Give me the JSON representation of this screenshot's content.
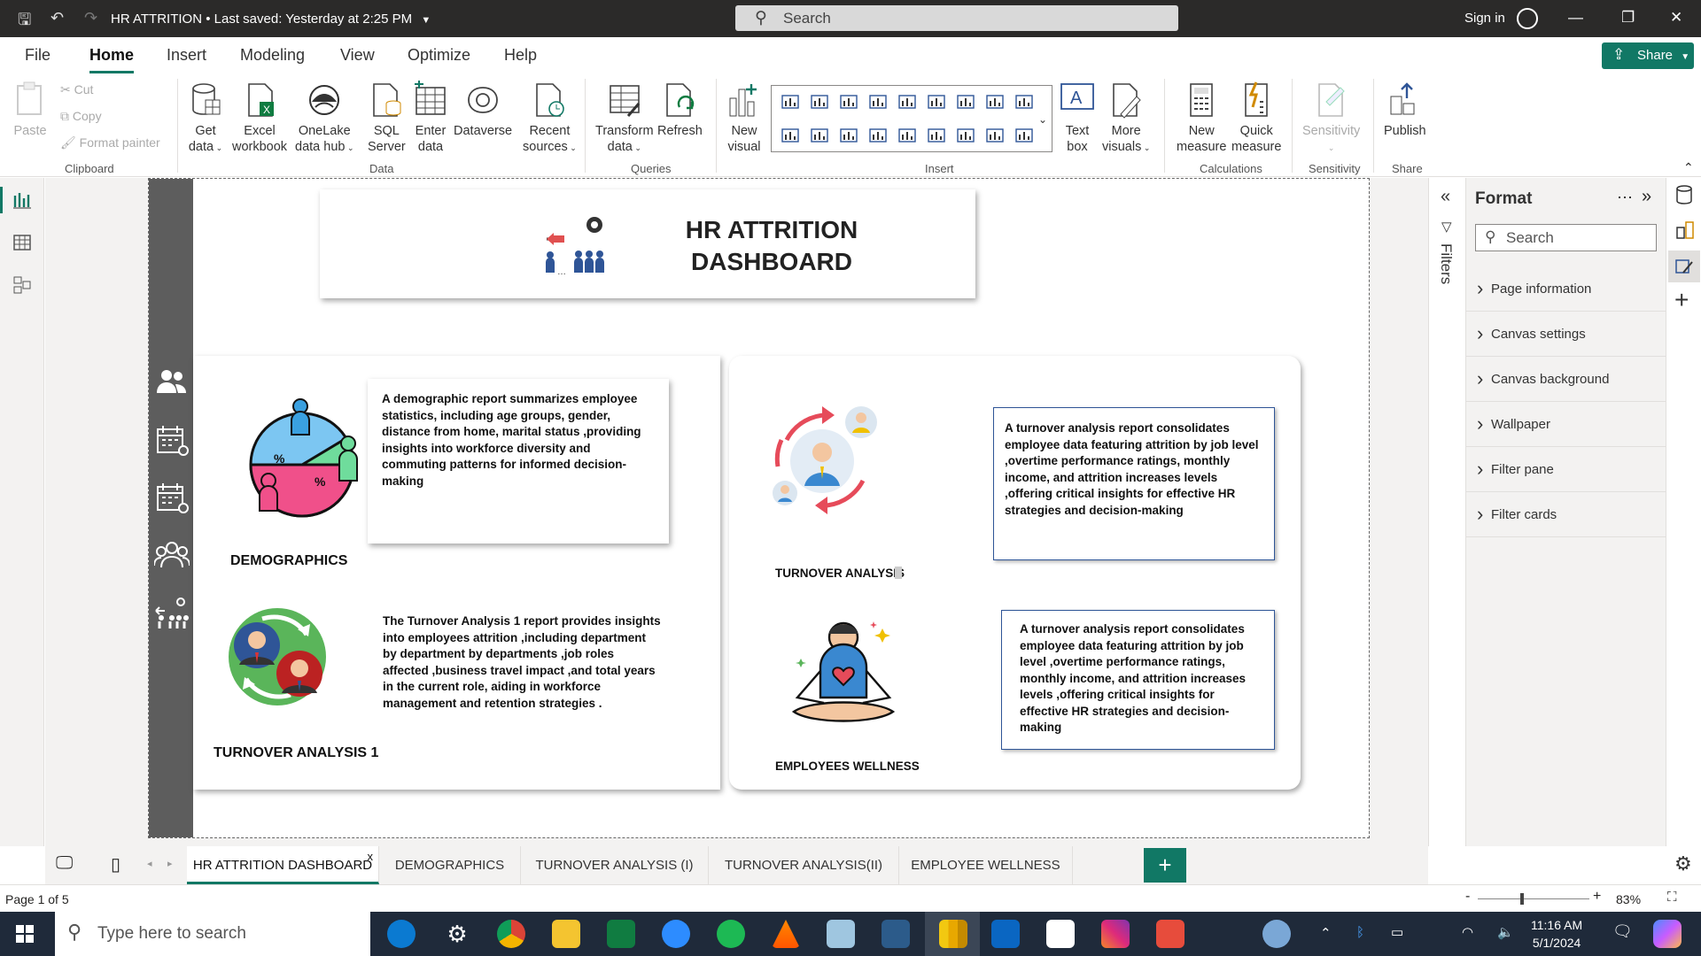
{
  "window": {
    "title": "HR ATTRITION",
    "saved_status": "Last saved: Yesterday at 2:25 PM",
    "search_placeholder": "Search",
    "sign_in": "Sign in"
  },
  "menu": {
    "tabs": [
      "File",
      "Home",
      "Insert",
      "Modeling",
      "View",
      "Optimize",
      "Help"
    ],
    "active": "Home",
    "share": "Share"
  },
  "ribbon": {
    "clipboard": {
      "paste": "Paste",
      "cut": "Cut",
      "copy": "Copy",
      "format_painter": "Format painter",
      "label": "Clipboard"
    },
    "data": {
      "get_data": [
        "Get",
        "data"
      ],
      "excel": [
        "Excel",
        "workbook"
      ],
      "onelake": [
        "OneLake",
        "data hub"
      ],
      "sql": [
        "SQL",
        "Server"
      ],
      "enter": [
        "Enter",
        "data"
      ],
      "dataverse": "Dataverse",
      "recent": [
        "Recent",
        "sources"
      ],
      "label": "Data"
    },
    "queries": {
      "transform": [
        "Transform",
        "data"
      ],
      "refresh": "Refresh",
      "label": "Queries"
    },
    "insert": {
      "new_visual": [
        "New",
        "visual"
      ],
      "text_box": [
        "Text",
        "box"
      ],
      "more_visuals": [
        "More",
        "visuals"
      ],
      "label": "Insert"
    },
    "calculations": {
      "new_measure": [
        "New",
        "measure"
      ],
      "quick_measure": [
        "Quick",
        "measure"
      ],
      "label": "Calculations"
    },
    "sensitivity": {
      "button": "Sensitivity",
      "label": "Sensitivity"
    },
    "share": {
      "publish": "Publish",
      "label": "Share"
    }
  },
  "report": {
    "title_line1": "HR ATTRITION",
    "title_line2": "DASHBOARD",
    "demographics_label": "DEMOGRAPHICS",
    "demographics_text": "A demographic report summarizes employee statistics, including age groups, gender, distance from home, marital status ,providing insights into workforce diversity and commuting patterns for informed decision-making",
    "turnover1_label": "TURNOVER ANALYSIS 1",
    "turnover1_text": "The Turnover Analysis 1 report provides insights into employees attrition ,including department by department by departments ,job roles affected ,business travel impact ,and total years in the current role, aiding in workforce management and retention strategies .",
    "turnover_label": "TURNOVER ANALYSIS",
    "turnover_text": "A turnover analysis report consolidates employee data featuring attrition by job level ,overtime performance ratings, monthly income, and attrition increases levels  ,offering critical insights for effective HR strategies and decision-making",
    "wellness_label": "EMPLOYEES WELLNESS",
    "wellness_text": "A turnover analysis report consolidates employee data featuring attrition by job level ,overtime performance ratings, monthly income, and attrition increases levels  ,offering critical insights for effective HR strategies and decision-making"
  },
  "filters": {
    "label": "Filters"
  },
  "format_pane": {
    "title": "Format",
    "search_placeholder": "Search",
    "items": [
      "Page information",
      "Canvas settings",
      "Canvas background",
      "Wallpaper",
      "Filter pane",
      "Filter cards"
    ]
  },
  "page_tabs": {
    "tabs": [
      "HR ATTRITION DASHBOARD",
      "DEMOGRAPHICS",
      "TURNOVER ANALYSIS (I)",
      "TURNOVER ANALYSIS(II)",
      "EMPLOYEE WELLNESS"
    ],
    "active_index": 0,
    "close": "x",
    "add": "+"
  },
  "status": {
    "page": "Page 1 of 5",
    "zoom": "83%"
  },
  "taskbar": {
    "search_placeholder": "Type here to search",
    "time": "11:16 AM",
    "date": "5/1/2024"
  }
}
